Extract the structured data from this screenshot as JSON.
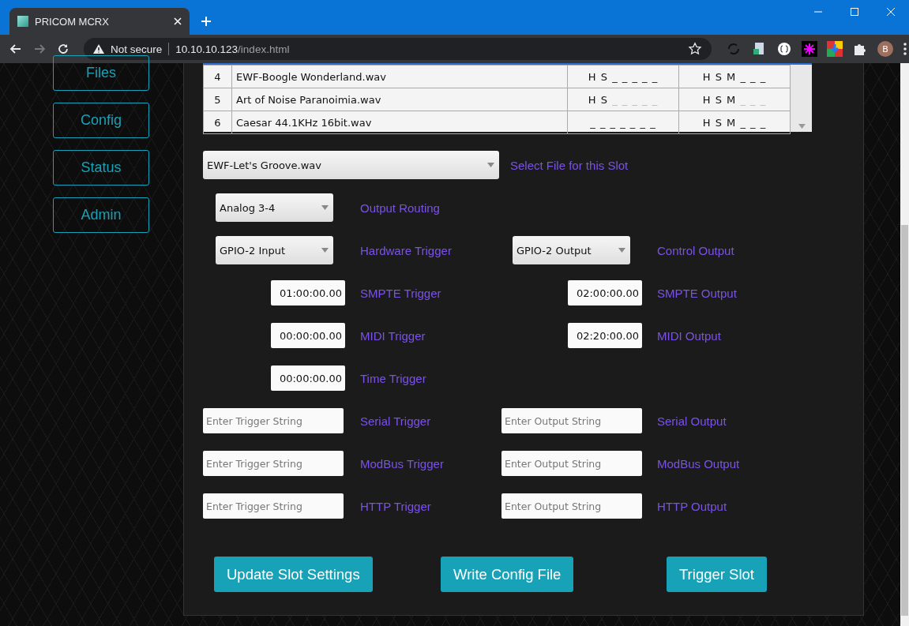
{
  "browser": {
    "tab_title": "PRICOM MCRX",
    "security": "Not secure",
    "url_host": "10.10.10.123",
    "url_path": "/index.html",
    "avatar": "B"
  },
  "nav": [
    {
      "label": "Files"
    },
    {
      "label": "Config"
    },
    {
      "label": "Status"
    },
    {
      "label": "Admin"
    }
  ],
  "table": {
    "rows": [
      {
        "number": "4",
        "file": "EWF-Boogle Wonderland.wav",
        "column_3": [
          {
            "text": "H S",
            "dim": false
          },
          {
            "text": "_ _ _ _ _",
            "dim": false
          }
        ],
        "column_4": [
          {
            "text": "H S M",
            "dim": false
          },
          {
            "text": "_ _ _",
            "dim": false
          }
        ]
      },
      {
        "number": "5",
        "file": "Art of Noise Paranoimia.wav",
        "column_3": [
          {
            "text": "H S",
            "dim": false
          },
          {
            "text": "_ _ _ _ _",
            "dim": true
          }
        ],
        "column_4": [
          {
            "text": "H S M",
            "dim": false
          },
          {
            "text": "_ _ _",
            "dim": true
          }
        ]
      },
      {
        "number": "6",
        "file": "Caesar 44.1KHz 16bit.wav",
        "column_3": [
          {
            "text": "_ _ _ _ _ _ _",
            "dim": false
          }
        ],
        "column_4": [
          {
            "text": "H S M",
            "dim": false
          },
          {
            "text": "_ _ _",
            "dim": false
          }
        ]
      }
    ]
  },
  "file_select": {
    "value": "EWF-Let's Groove.wav",
    "label": "Select File for this Slot"
  },
  "rows": [
    {
      "left": {
        "kind": "select",
        "value": "Analog 3-4",
        "label": "Output Routing"
      }
    },
    {
      "left": {
        "kind": "select",
        "value": "GPIO-2 Input",
        "label": "Hardware Trigger"
      },
      "right": {
        "kind": "select",
        "value": "GPIO-2 Output",
        "label": "Control Output"
      }
    },
    {
      "left": {
        "kind": "time",
        "value": "01:00:00.00",
        "label": "SMPTE Trigger"
      },
      "right": {
        "kind": "time",
        "value": "02:00:00.00",
        "label": "SMPTE Output"
      }
    },
    {
      "left": {
        "kind": "time",
        "value": "00:00:00.00",
        "label": "MIDI Trigger"
      },
      "right": {
        "kind": "time",
        "value": "02:20:00.00",
        "label": "MIDI Output"
      }
    },
    {
      "left": {
        "kind": "time",
        "value": "00:00:00.00",
        "label": "Time Trigger"
      }
    },
    {
      "left": {
        "kind": "text",
        "placeholder": "Enter Trigger String",
        "label": "Serial Trigger"
      },
      "right": {
        "kind": "text",
        "placeholder": "Enter Output String",
        "label": "Serial Output"
      }
    },
    {
      "left": {
        "kind": "text",
        "placeholder": "Enter Trigger String",
        "label": "ModBus Trigger"
      },
      "right": {
        "kind": "text",
        "placeholder": "Enter Output String",
        "label": "ModBus Output"
      }
    },
    {
      "left": {
        "kind": "text",
        "placeholder": "Enter Trigger String",
        "label": "HTTP Trigger"
      },
      "right": {
        "kind": "text",
        "placeholder": "Enter Output String",
        "label": "HTTP Output"
      }
    }
  ],
  "buttons": [
    {
      "label": "Update Slot Settings"
    },
    {
      "label": "Write Config File"
    },
    {
      "label": "Trigger Slot"
    }
  ]
}
